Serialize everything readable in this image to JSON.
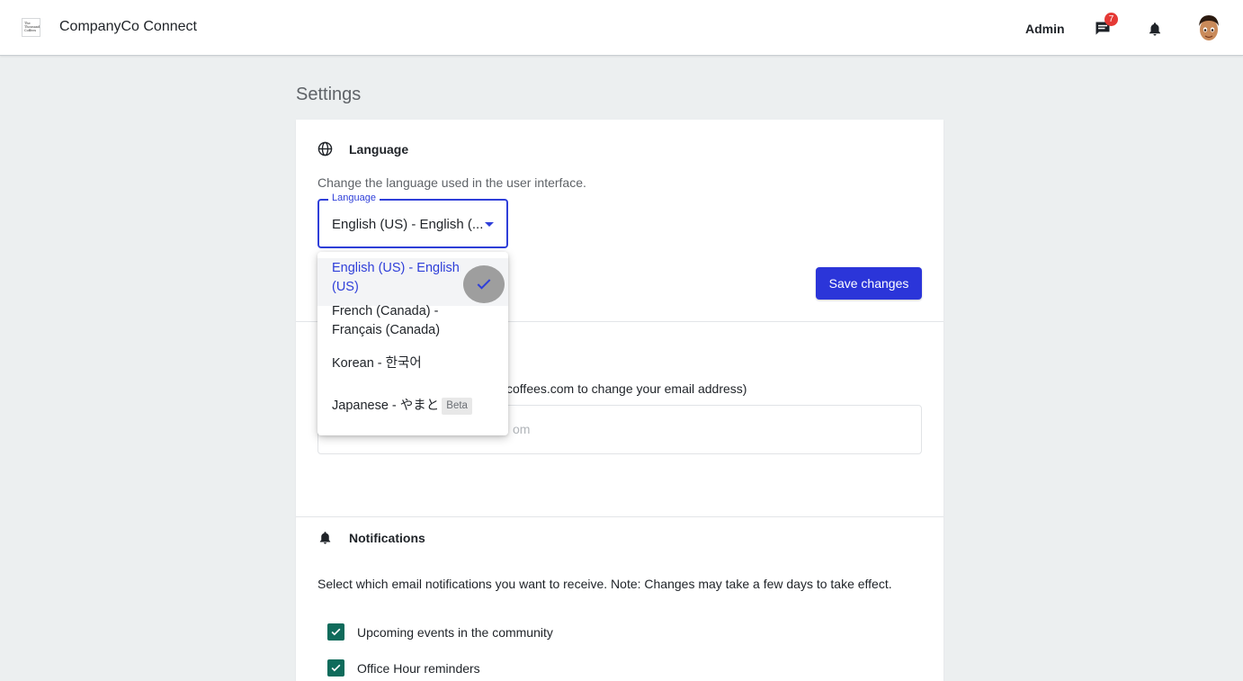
{
  "app": {
    "title": "CompanyCo Connect",
    "logo_text": "The Thousand Coffees",
    "user_role": "Admin",
    "message_count": "7"
  },
  "page": {
    "heading": "Settings"
  },
  "language_section": {
    "title": "Language",
    "description": "Change the language used in the user interface.",
    "select_label": "Language",
    "select_value": "English (US) - English (...",
    "save_label": "Save changes",
    "options": [
      {
        "label": "English (US) - English (US)",
        "selected": true
      },
      {
        "label": "French (Canada) - Français (Canada)",
        "selected": false
      },
      {
        "label": "Korean - 한국어",
        "selected": false
      },
      {
        "label": "Japanese - やまと",
        "badge": "Beta",
        "selected": false
      }
    ]
  },
  "email_section": {
    "description_visible": "coffees.com to change your email address)",
    "input_value_visible": "om"
  },
  "notifications_section": {
    "title": "Notifications",
    "description": "Select which email notifications you want to receive. Note: Changes may take a few days to take effect.",
    "items": [
      {
        "label": "Upcoming events in the community",
        "checked": true
      },
      {
        "label": "Office Hour reminders",
        "checked": true
      }
    ]
  },
  "colors": {
    "primary": "#2b35d9",
    "checkbox": "#0f6b5b",
    "badge": "#e53935",
    "background": "#eceff0"
  },
  "icons": {
    "language": "globe-icon",
    "notifications": "bell-icon",
    "messages": "chat-icon",
    "selected": "checkmark-icon"
  }
}
